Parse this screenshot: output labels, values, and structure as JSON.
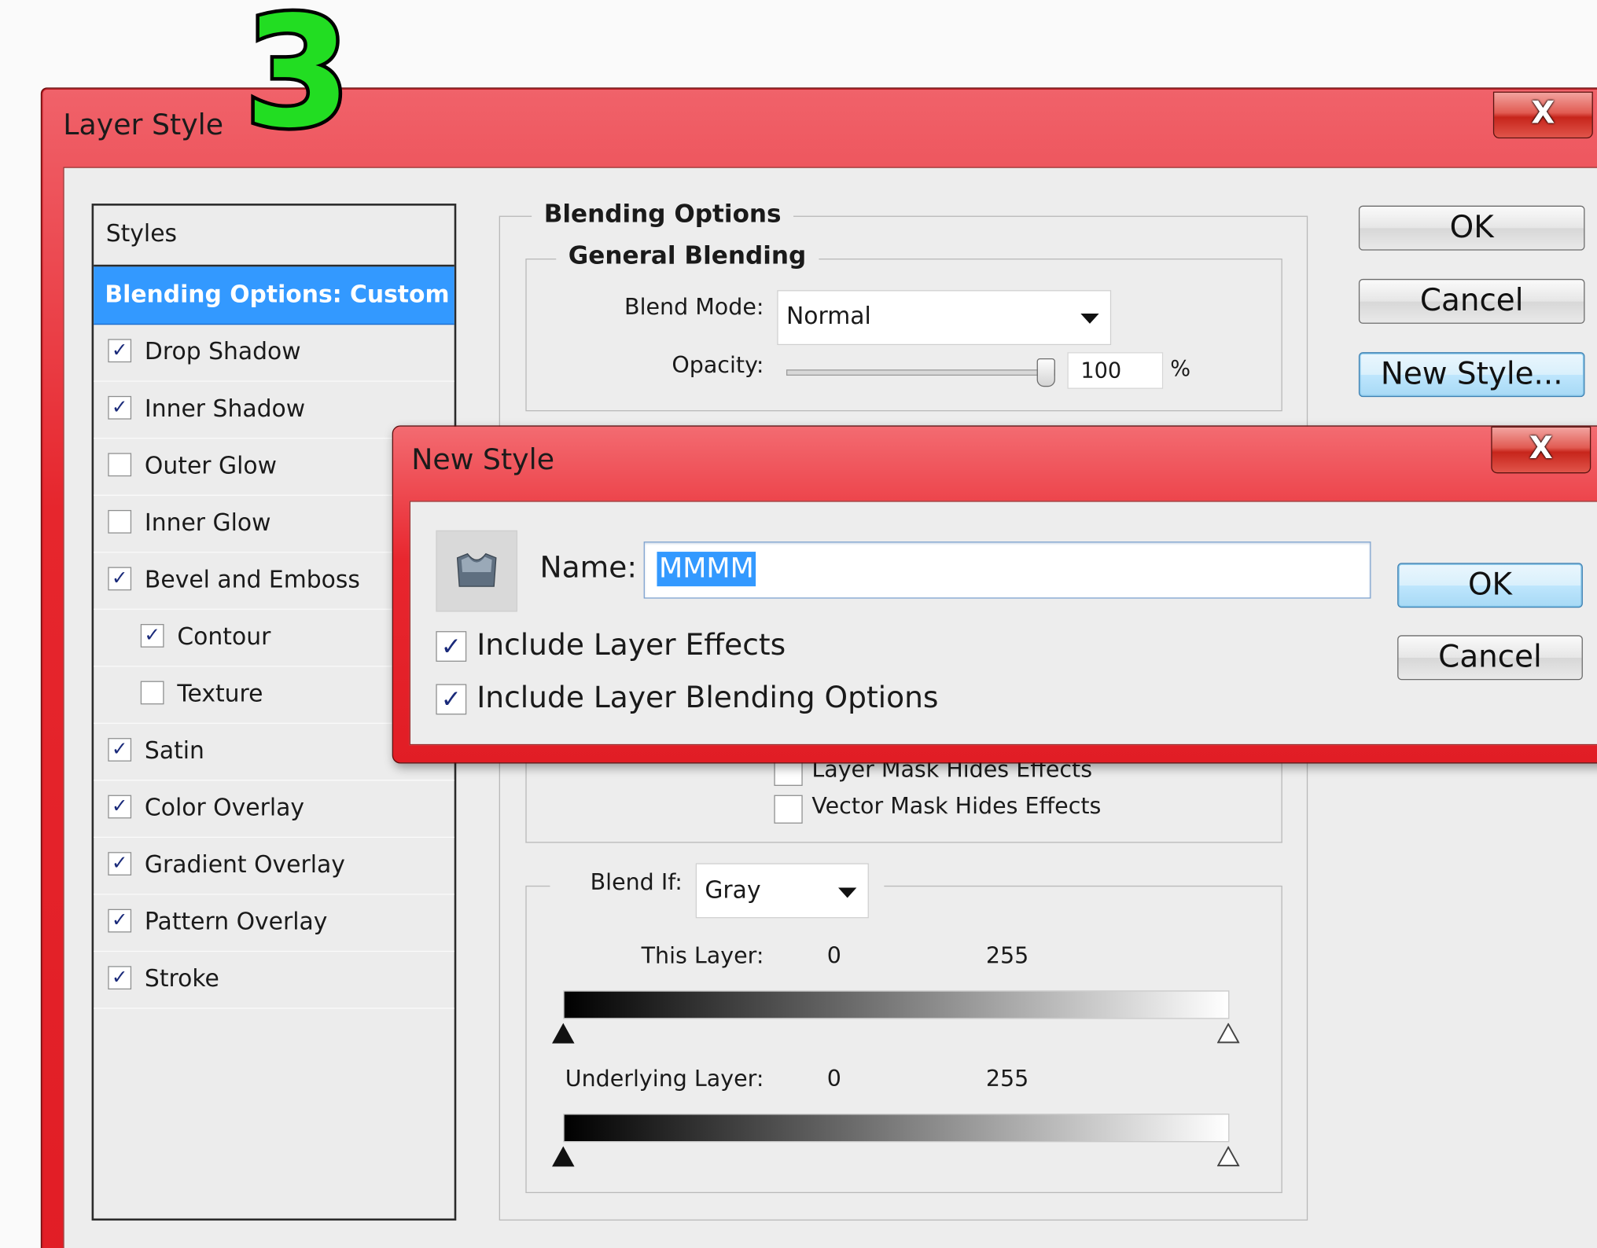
{
  "annotation": {
    "step_number": "3"
  },
  "main_window": {
    "title": "Layer Style",
    "close_glyph": "X",
    "styles_panel": {
      "header": "Styles",
      "selected_item": "Blending Options: Custom",
      "items": [
        {
          "label": "Drop Shadow",
          "checked": true,
          "check_mark": "✓",
          "indent": false
        },
        {
          "label": "Inner Shadow",
          "checked": true,
          "check_mark": "✓",
          "indent": false
        },
        {
          "label": "Outer Glow",
          "checked": false,
          "check_mark": "",
          "indent": false
        },
        {
          "label": "Inner Glow",
          "checked": false,
          "check_mark": "",
          "indent": false
        },
        {
          "label": "Bevel and Emboss",
          "checked": true,
          "check_mark": "✓",
          "indent": false
        },
        {
          "label": "Contour",
          "checked": true,
          "check_mark": "✓",
          "indent": true
        },
        {
          "label": "Texture",
          "checked": false,
          "check_mark": "",
          "indent": true
        },
        {
          "label": "Satin",
          "checked": true,
          "check_mark": "✓",
          "indent": false
        },
        {
          "label": "Color Overlay",
          "checked": true,
          "check_mark": "✓",
          "indent": false
        },
        {
          "label": "Gradient Overlay",
          "checked": true,
          "check_mark": "✓",
          "indent": false
        },
        {
          "label": "Pattern Overlay",
          "checked": true,
          "check_mark": "✓",
          "indent": false
        },
        {
          "label": "Stroke",
          "checked": true,
          "check_mark": "✓",
          "indent": false
        }
      ]
    },
    "blending_options": {
      "title": "Blending Options",
      "general_blending": {
        "title": "General Blending",
        "blend_mode_label": "Blend Mode:",
        "blend_mode_value": "Normal",
        "opacity_label": "Opacity:",
        "opacity_value": "100",
        "opacity_unit": "%",
        "opacity_level": 1.0
      },
      "advanced": {
        "layer_mask_hides_effects": "Layer Mask Hides Effects",
        "vector_mask_hides_effects": "Vector Mask Hides Effects"
      },
      "blend_if": {
        "label": "Blend If:",
        "value": "Gray",
        "this_layer_label": "This Layer:",
        "this_layer_min": "0",
        "this_layer_max": "255",
        "underlying_layer_label": "Underlying Layer:",
        "underlying_layer_min": "0",
        "underlying_layer_max": "255"
      }
    },
    "buttons": {
      "ok": "OK",
      "cancel": "Cancel",
      "new_style": "New Style..."
    }
  },
  "new_style_dialog": {
    "title": "New Style",
    "close_glyph": "X",
    "name_label": "Name:",
    "name_value": "MMMM",
    "include_layer_effects": {
      "label": "Include Layer Effects",
      "checked": true,
      "check_mark": "✓"
    },
    "include_blending_options": {
      "label": "Include Layer Blending Options",
      "checked": true,
      "check_mark": "✓"
    },
    "ok": "OK",
    "cancel": "Cancel"
  },
  "colors": {
    "titlebar_red": "#e11d25",
    "selection_blue": "#3399ff",
    "step_green": "#22dd22"
  }
}
